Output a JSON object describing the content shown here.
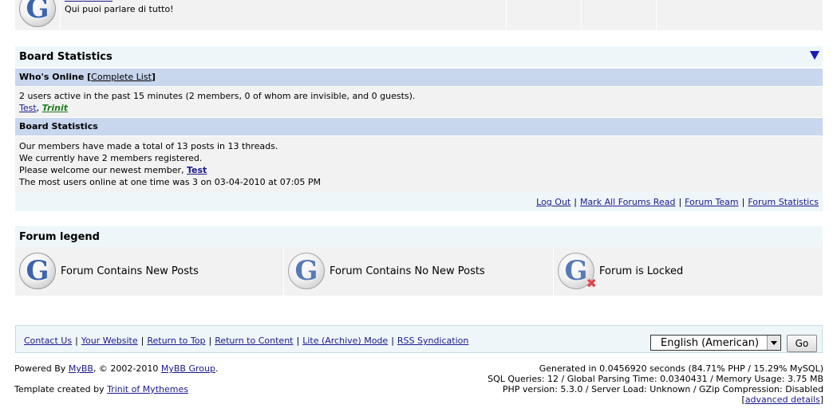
{
  "top_forum": {
    "description": "Qui puoi parlare di tutto!"
  },
  "board_stats": {
    "title": "Board Statistics",
    "whos_online": {
      "label": "Who's Online",
      "link_prefix": "[",
      "link": "Complete List",
      "link_suffix": "]",
      "summary": "2 users active in the past 15 minutes (2 members, 0 of whom are invisible, and 0 guests).",
      "users": [
        "Test",
        "Trinit"
      ],
      "user_sep": ", "
    },
    "stats": {
      "label": "Board Statistics",
      "line1": "Our members have made a total of 13 posts in 13 threads.",
      "line2": "We currently have 2 members registered.",
      "line3_prefix": "Please welcome our newest member, ",
      "newest_member": "Test",
      "line4": "The most users online at one time was 3 on 03-04-2010 at 07:05 PM"
    },
    "links": [
      "Log Out",
      "Mark All Forums Read",
      "Forum Team",
      "Forum Statistics"
    ],
    "link_sep": "|"
  },
  "legend": {
    "title": "Forum legend",
    "items": [
      "Forum Contains New Posts",
      "Forum Contains No New Posts",
      "Forum is Locked"
    ]
  },
  "footer": {
    "links": [
      "Contact Us",
      "Your Website",
      "Return to Top",
      "Return to Content",
      "Lite (Archive) Mode",
      "RSS Syndication"
    ],
    "link_sep": "|",
    "language": "English (American)",
    "go": "Go",
    "powered_prefix": "Powered By ",
    "mybb": "MyBB",
    "powered_mid": ", © 2002-2010 ",
    "mybb_group": "MyBB Group",
    "powered_suffix": ".",
    "template_prefix": "Template created by ",
    "template_author": "Trinit of Mythemes",
    "debug_line1": "Generated in 0.0456920 seconds (84.71% PHP / 15.29% MySQL)",
    "debug_line2": "SQL Queries: 12 / Global Parsing Time: 0.0340431 / Memory Usage: 3.75 MB",
    "debug_line3": "PHP version: 5.3.0 / Server Load: Unknown / GZip Compression: Disabled",
    "advanced_open": "[",
    "advanced": "advanced details",
    "advanced_close": "]"
  },
  "icon_color": "#3b64ad",
  "accent_color": "#c8d6ee"
}
